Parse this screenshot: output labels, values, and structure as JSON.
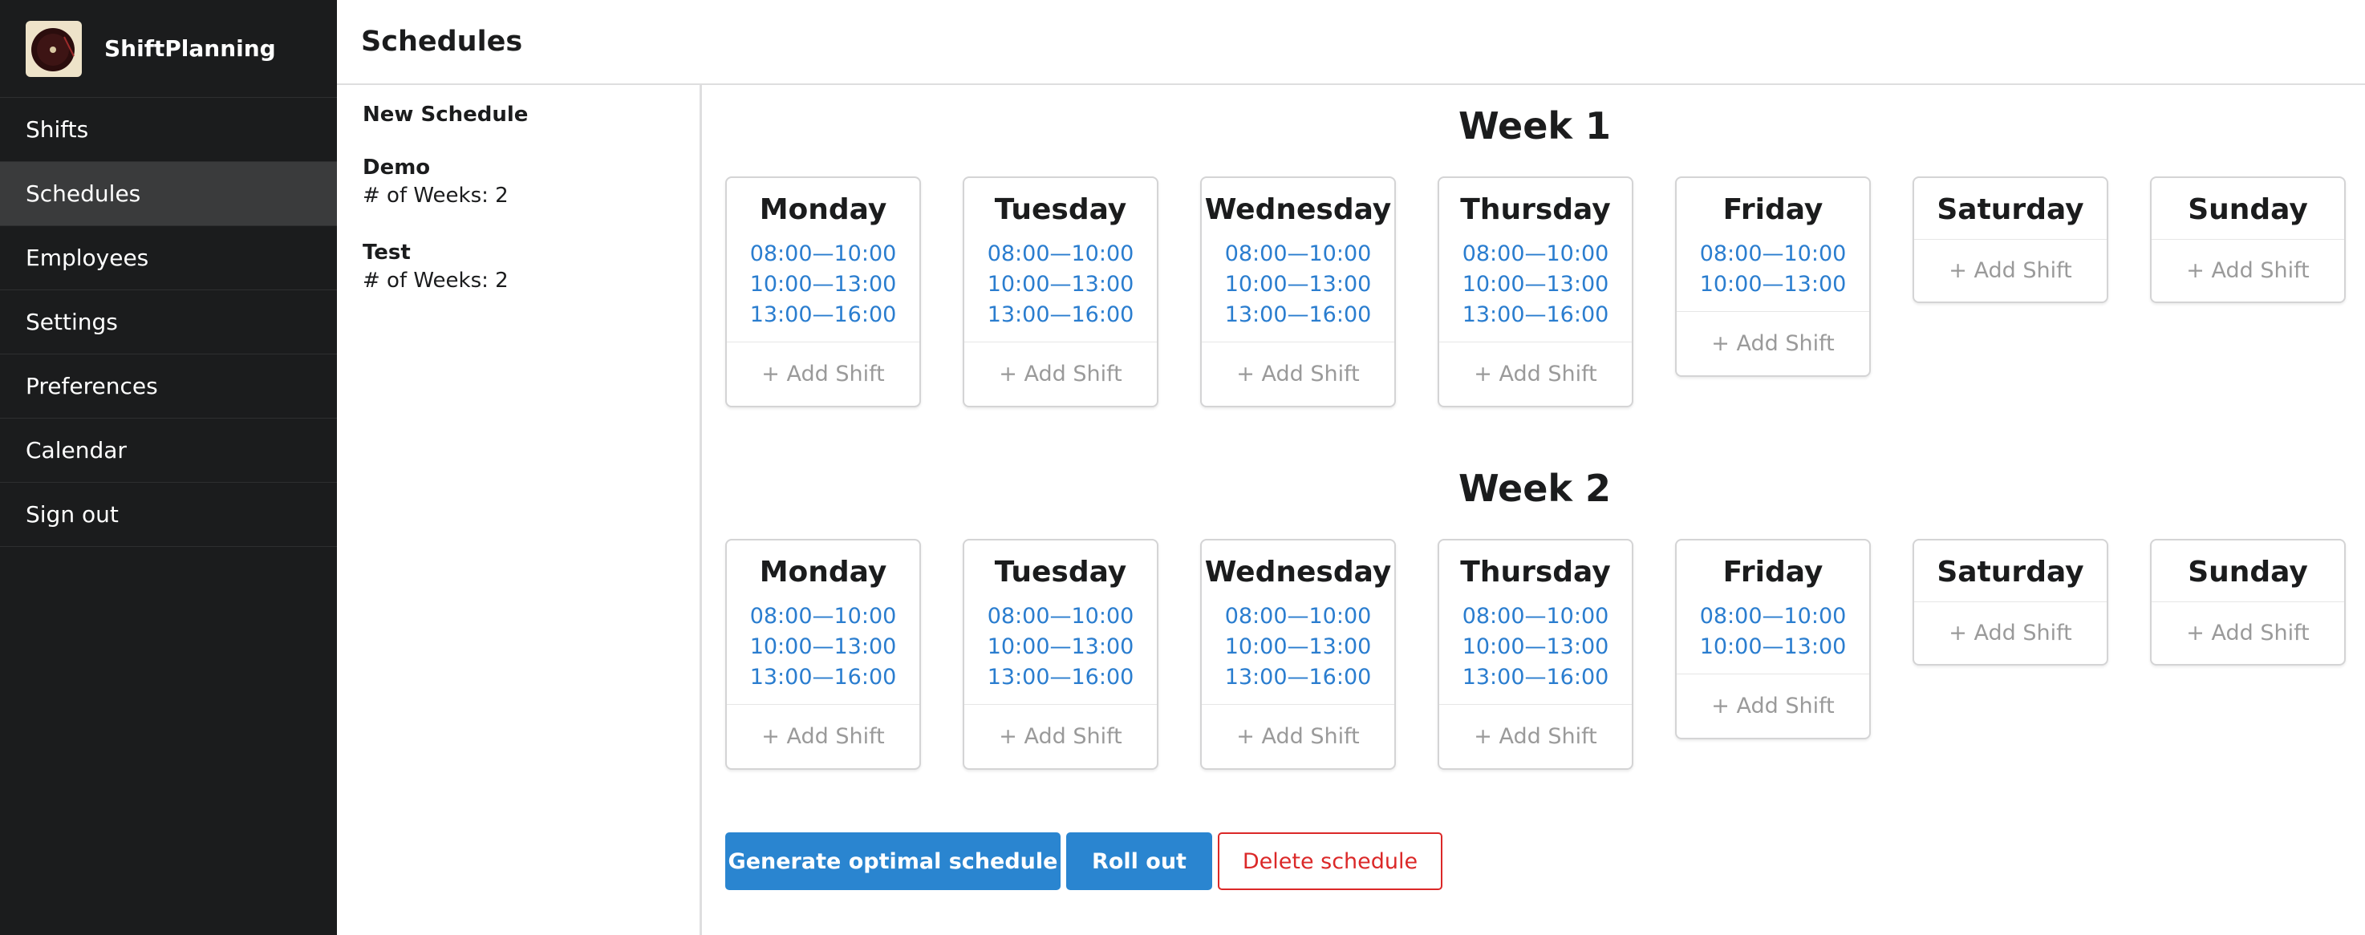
{
  "app": {
    "name": "ShiftPlanning",
    "accent": "#2a85d0",
    "danger": "#db2828",
    "shift_color": "#2a7dcf"
  },
  "sidebar": {
    "items": [
      {
        "label": "Shifts"
      },
      {
        "label": "Schedules",
        "active": true
      },
      {
        "label": "Employees"
      },
      {
        "label": "Settings"
      },
      {
        "label": "Preferences"
      },
      {
        "label": "Calendar"
      },
      {
        "label": "Sign out"
      }
    ]
  },
  "header": {
    "title": "Schedules"
  },
  "schedules": {
    "new_label": "New Schedule",
    "entries": [
      {
        "name": "Demo",
        "weeks": "# of Weeks: 2"
      },
      {
        "name": "Test",
        "weeks": "# of Weeks: 2"
      }
    ]
  },
  "weeks": [
    {
      "title": "Week 1",
      "days": [
        {
          "name": "Monday",
          "shifts": [
            "08:00—10:00",
            "10:00—13:00",
            "13:00—16:00"
          ]
        },
        {
          "name": "Tuesday",
          "shifts": [
            "08:00—10:00",
            "10:00—13:00",
            "13:00—16:00"
          ]
        },
        {
          "name": "Wednesday",
          "shifts": [
            "08:00—10:00",
            "10:00—13:00",
            "13:00—16:00"
          ]
        },
        {
          "name": "Thursday",
          "shifts": [
            "08:00—10:00",
            "10:00—13:00",
            "13:00—16:00"
          ]
        },
        {
          "name": "Friday",
          "shifts": [
            "08:00—10:00",
            "10:00—13:00"
          ]
        },
        {
          "name": "Saturday",
          "shifts": []
        },
        {
          "name": "Sunday",
          "shifts": []
        }
      ]
    },
    {
      "title": "Week 2",
      "days": [
        {
          "name": "Monday",
          "shifts": [
            "08:00—10:00",
            "10:00—13:00",
            "13:00—16:00"
          ]
        },
        {
          "name": "Tuesday",
          "shifts": [
            "08:00—10:00",
            "10:00—13:00",
            "13:00—16:00"
          ]
        },
        {
          "name": "Wednesday",
          "shifts": [
            "08:00—10:00",
            "10:00—13:00",
            "13:00—16:00"
          ]
        },
        {
          "name": "Thursday",
          "shifts": [
            "08:00—10:00",
            "10:00—13:00",
            "13:00—16:00"
          ]
        },
        {
          "name": "Friday",
          "shifts": [
            "08:00—10:00",
            "10:00—13:00"
          ]
        },
        {
          "name": "Saturday",
          "shifts": []
        },
        {
          "name": "Sunday",
          "shifts": []
        }
      ]
    }
  ],
  "add_shift_label": "+ Add Shift",
  "actions": {
    "generate_label": "Generate optimal schedule",
    "rollout_label": "Roll out",
    "delete_label": "Delete schedule"
  }
}
